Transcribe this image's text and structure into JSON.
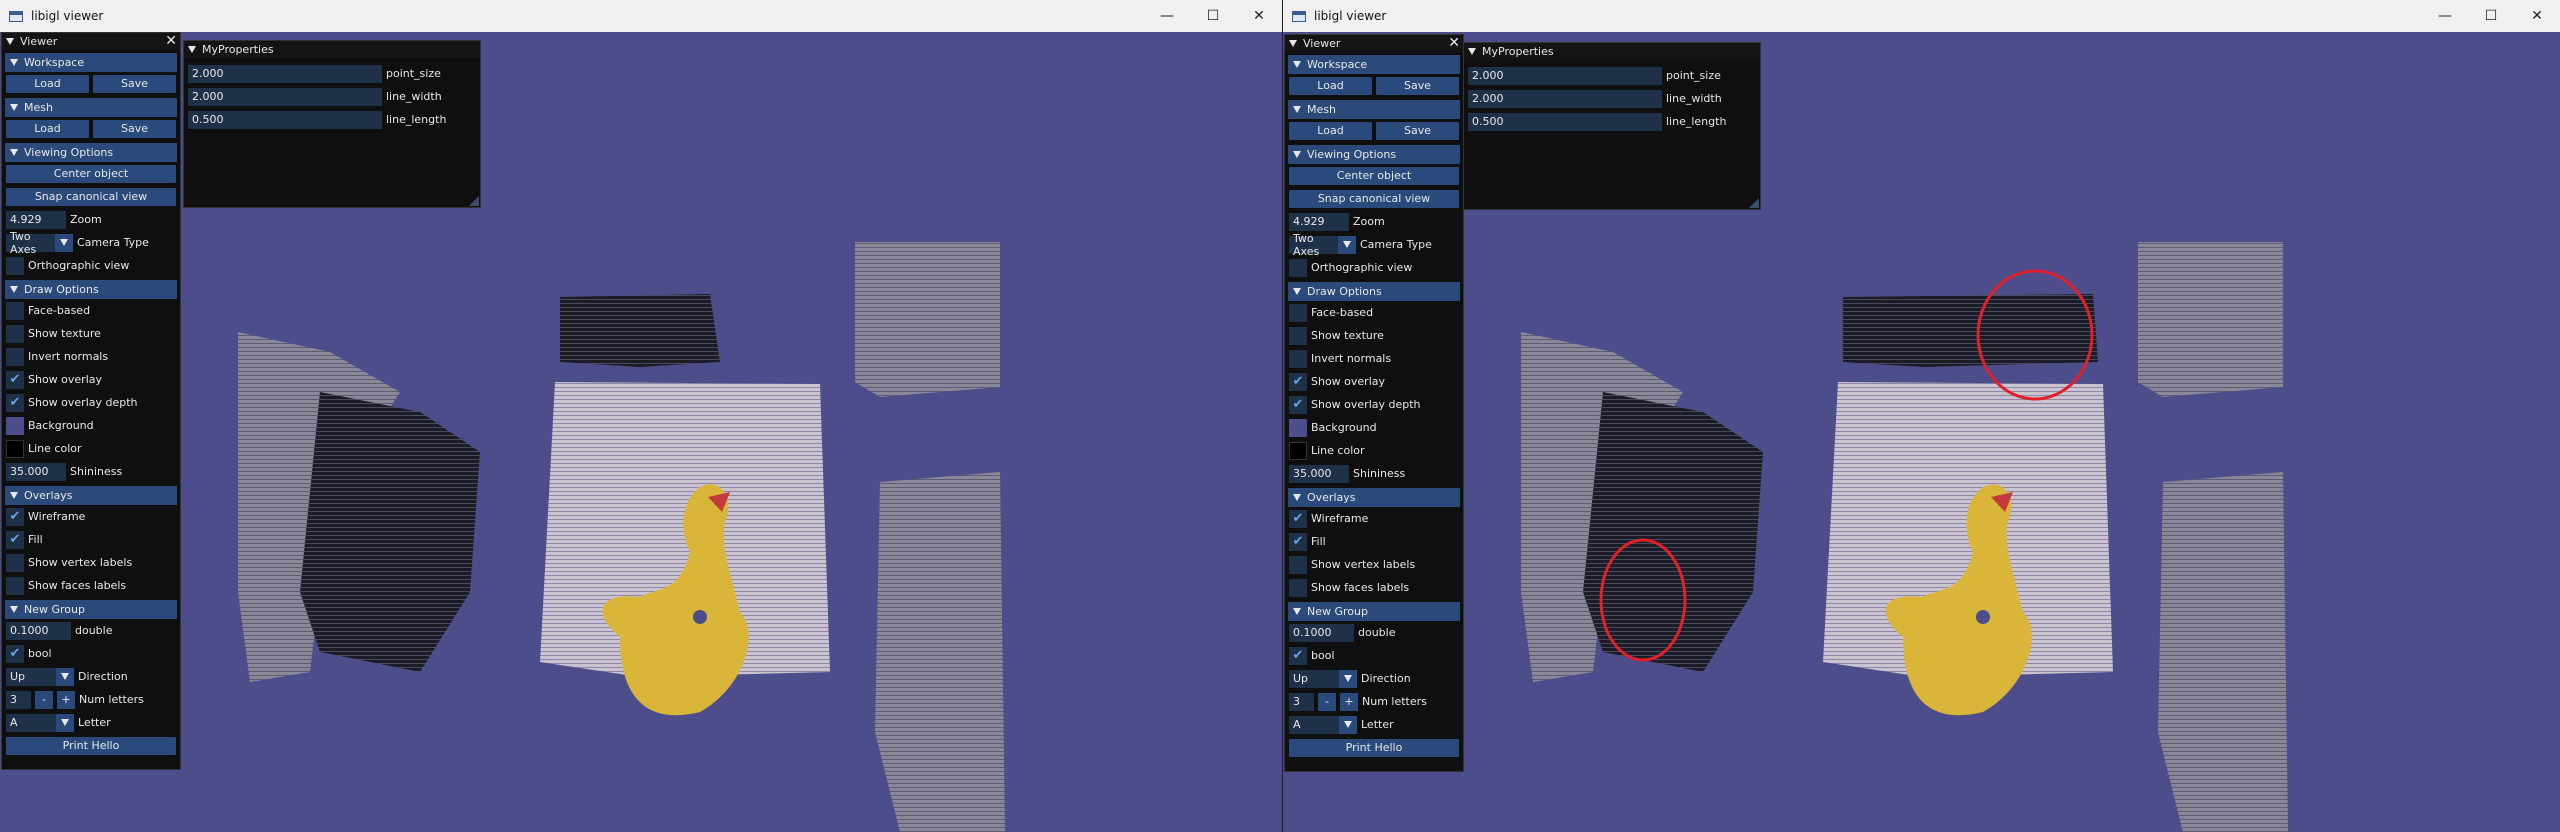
{
  "window_title": "libigl viewer",
  "window_controls": {
    "minimize": "—",
    "maximize": "☐",
    "close": "✕"
  },
  "viewer": {
    "title": "Viewer",
    "close": "✕",
    "workspace": {
      "header": "Workspace",
      "load": "Load",
      "save": "Save"
    },
    "mesh": {
      "header": "Mesh",
      "load": "Load",
      "save": "Save"
    },
    "viewing_options": {
      "header": "Viewing Options",
      "center_object": "Center object",
      "snap_canonical": "Snap canonical view",
      "zoom_value": "4.929",
      "zoom_label": "Zoom",
      "camera_value": "Two Axes",
      "camera_label": "Camera Type",
      "orthographic": "Orthographic view"
    },
    "draw_options": {
      "header": "Draw Options",
      "face_based": "Face-based",
      "show_texture": "Show texture",
      "invert_normals": "Invert normals",
      "show_overlay": "Show overlay",
      "show_overlay_depth": "Show overlay depth",
      "background": "Background",
      "line_color": "Line color",
      "shininess_value": "35.000",
      "shininess_label": "Shininess"
    },
    "overlays": {
      "header": "Overlays",
      "wireframe": "Wireframe",
      "fill": "Fill",
      "vertex_labels": "Show vertex labels",
      "face_labels": "Show faces labels"
    },
    "new_group": {
      "header": "New Group",
      "double_value": "0.1000",
      "double_label": "double",
      "bool_label": "bool",
      "direction_value": "Up",
      "direction_label": "Direction",
      "num_value": "3",
      "minus": "-",
      "plus": "+",
      "num_label": "Num letters",
      "letter_value": "A",
      "letter_label": "Letter",
      "print_hello": "Print Hello"
    }
  },
  "my_properties": {
    "title": "MyProperties",
    "rows": [
      {
        "value": "2.000",
        "label": "point_size"
      },
      {
        "value": "2.000",
        "label": "line_width"
      },
      {
        "value": "0.500",
        "label": "line_length"
      }
    ]
  },
  "colors": {
    "scene_background": "#4d4d8c",
    "checked": "#6fa0e8",
    "background_swatch": "#4d4d8c",
    "line_color_swatch": "#000000",
    "annotation_circle": "#e0202a"
  }
}
